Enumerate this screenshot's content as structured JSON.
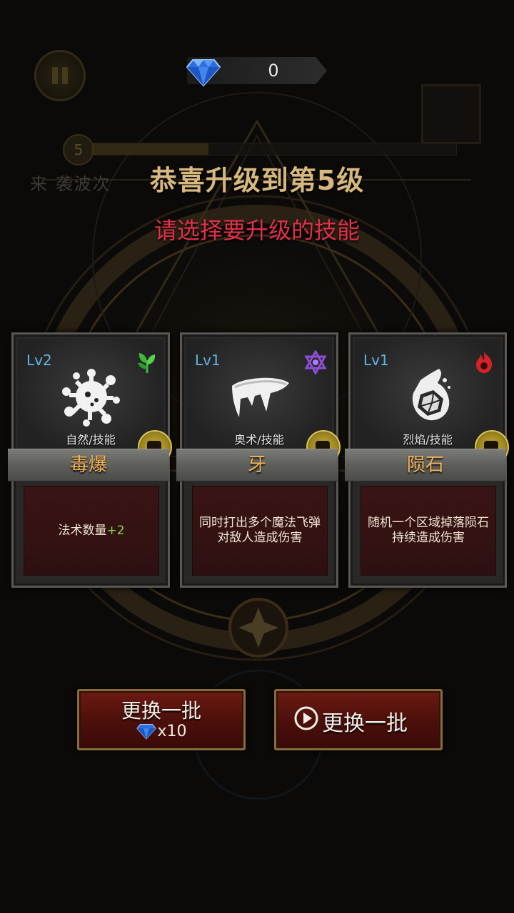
{
  "hud": {
    "gems": "0",
    "level_badge": "5",
    "wave_text": "来  袭波次"
  },
  "dialog": {
    "title": "恭喜升级到第5级",
    "subtitle": "请选择要升级的技能"
  },
  "cards": [
    {
      "level": "Lv2",
      "type_label": "自然/技能",
      "name": "毒爆",
      "desc_text": "法术数量",
      "desc_bonus": "+2",
      "type_icon": "leaf-icon",
      "art": "splat-icon"
    },
    {
      "level": "Lv1",
      "type_label": "奥术/技能",
      "name": "牙",
      "desc_text": "同时打出多个魔法飞弹对敌人造成伤害",
      "type_icon": "hexagram-icon",
      "art": "fang-icon"
    },
    {
      "level": "Lv1",
      "type_label": "烈焰/技能",
      "name": "陨石",
      "desc_text": "随机一个区域掉落陨石持续造成伤害",
      "type_icon": "flame-icon",
      "art": "meteor-icon"
    }
  ],
  "buttons": {
    "refresh_gem_label": "更换一批",
    "refresh_gem_cost": "x10",
    "refresh_ad_label": "更换一批"
  },
  "colors": {
    "title": "#d6b77f",
    "subtitle": "#e0304a",
    "level": "#5fb4e8",
    "skill_name": "#f0b35a",
    "bonus_green": "#7ddc4c"
  }
}
